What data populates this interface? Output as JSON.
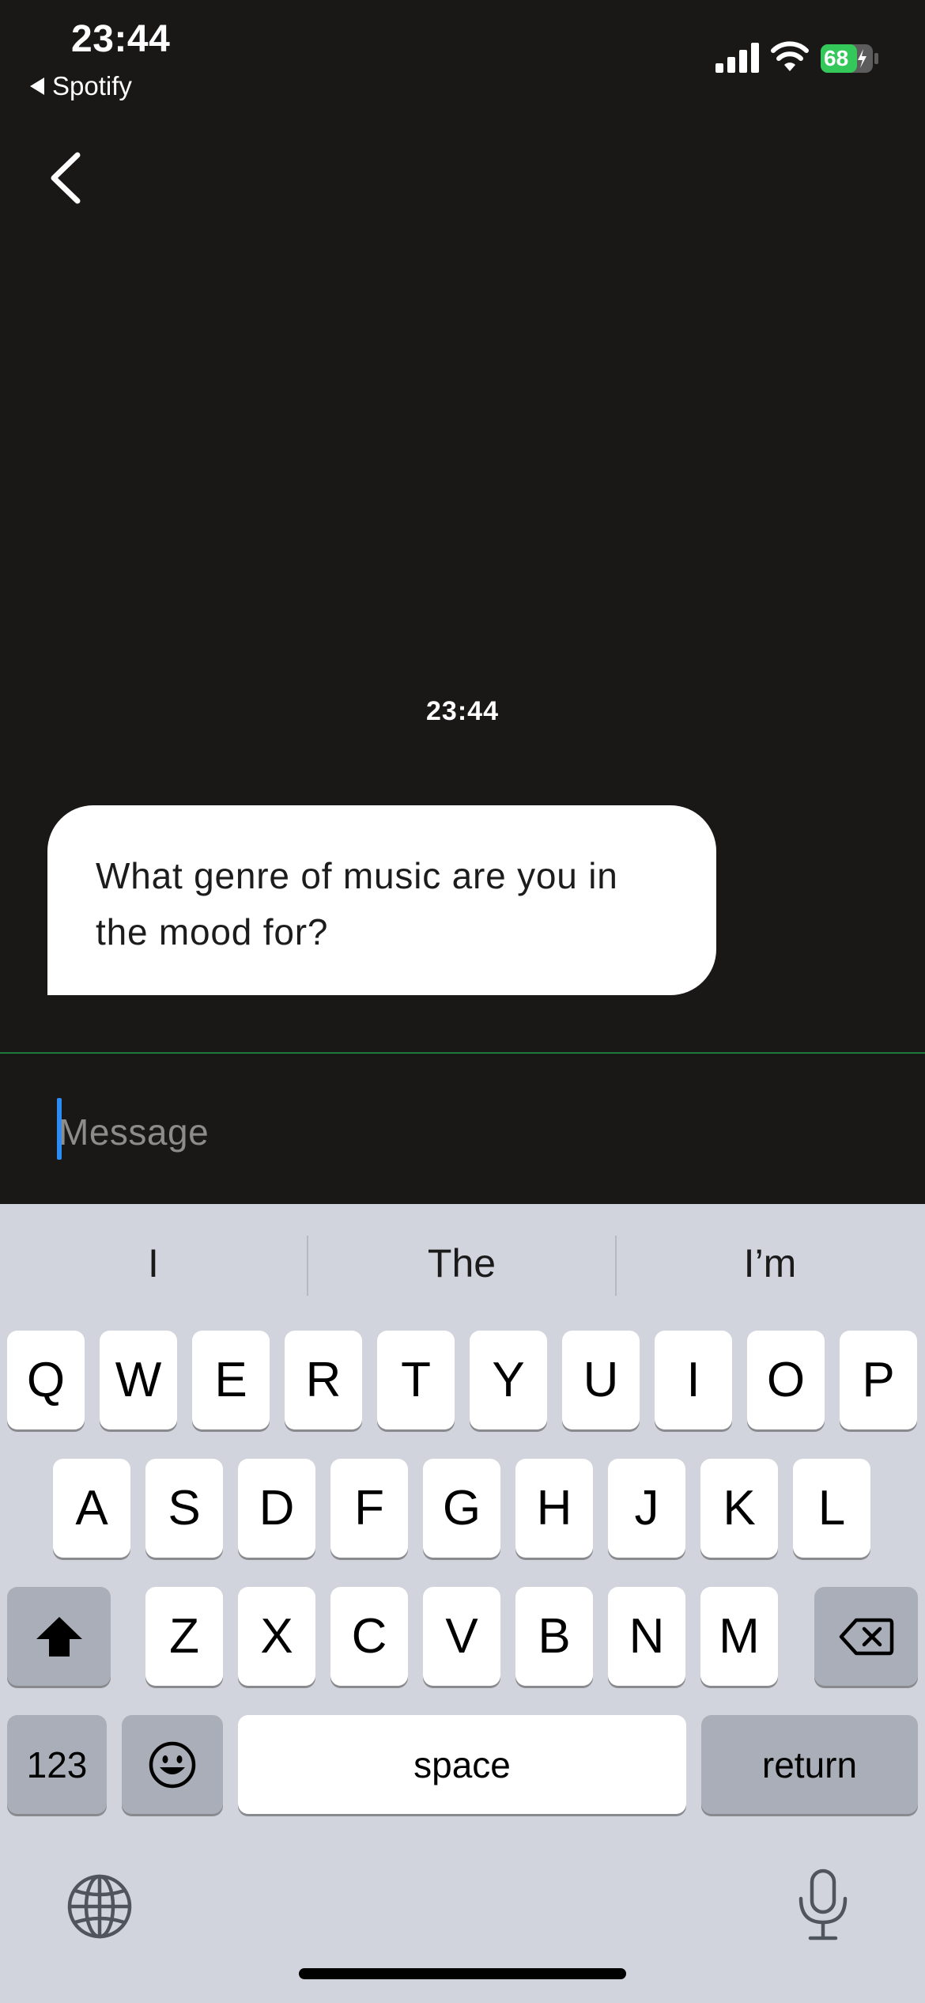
{
  "status_bar": {
    "time": "23:44",
    "back_app": "Spotify",
    "battery": "68"
  },
  "chat": {
    "timestamp": "23:44",
    "message": "What genre of music are you in the mood for?"
  },
  "composer": {
    "placeholder": "Message"
  },
  "keyboard": {
    "suggestions": [
      "I",
      "The",
      "I’m"
    ],
    "row1": [
      "Q",
      "W",
      "E",
      "R",
      "T",
      "Y",
      "U",
      "I",
      "O",
      "P"
    ],
    "row2": [
      "A",
      "S",
      "D",
      "F",
      "G",
      "H",
      "J",
      "K",
      "L"
    ],
    "row3": [
      "Z",
      "X",
      "C",
      "V",
      "B",
      "N",
      "M"
    ],
    "numbers_label": "123",
    "space_label": "space",
    "return_label": "return",
    "icons": [
      "shift-icon",
      "backspace-icon",
      "emoji-icon",
      "globe-icon",
      "microphone-icon"
    ]
  }
}
